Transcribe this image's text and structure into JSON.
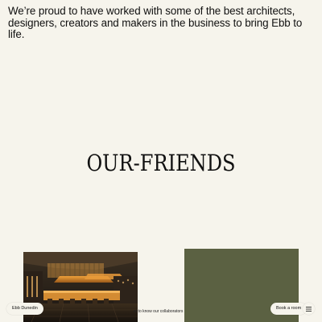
{
  "intro": {
    "text": "We’re proud to have worked with some of the best architects, designers, creators and makers in the business to bring Ebb to life."
  },
  "headline": {
    "text": "OUR-FRIENDS"
  },
  "gallery": {
    "caption": "et to know our collaborators",
    "green_card_color": "#5b6142"
  },
  "nav": {
    "location_label": "Ebb Dunedin",
    "book_label": "Book a room",
    "menu_icon": "hamburger-menu-icon"
  }
}
